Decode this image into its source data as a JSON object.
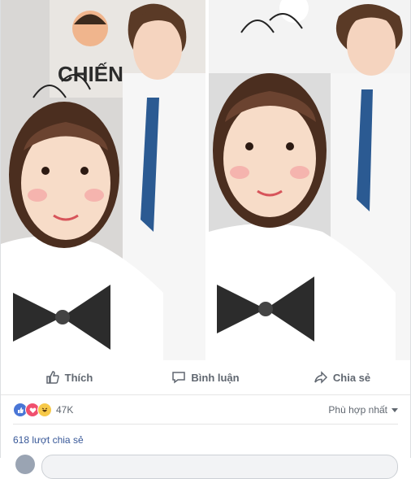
{
  "post": {
    "photos": [
      {
        "name": "left-photo",
        "banner_text": "CHIẾN"
      },
      {
        "name": "right-photo",
        "banner_text": ""
      }
    ],
    "actions": {
      "like_label": "Thích",
      "comment_label": "Bình luận",
      "share_label": "Chia sẻ"
    },
    "reactions": {
      "icons": [
        "like-icon",
        "love-icon",
        "haha-icon"
      ],
      "count": "47K"
    },
    "sort_label": "Phù hợp nhất",
    "shares_text": "618 lượt chia sẻ"
  },
  "colors": {
    "action_text": "#606770",
    "link": "#385898",
    "like": "#4a76d6",
    "love": "#f0506e",
    "haha": "#f7c949"
  }
}
